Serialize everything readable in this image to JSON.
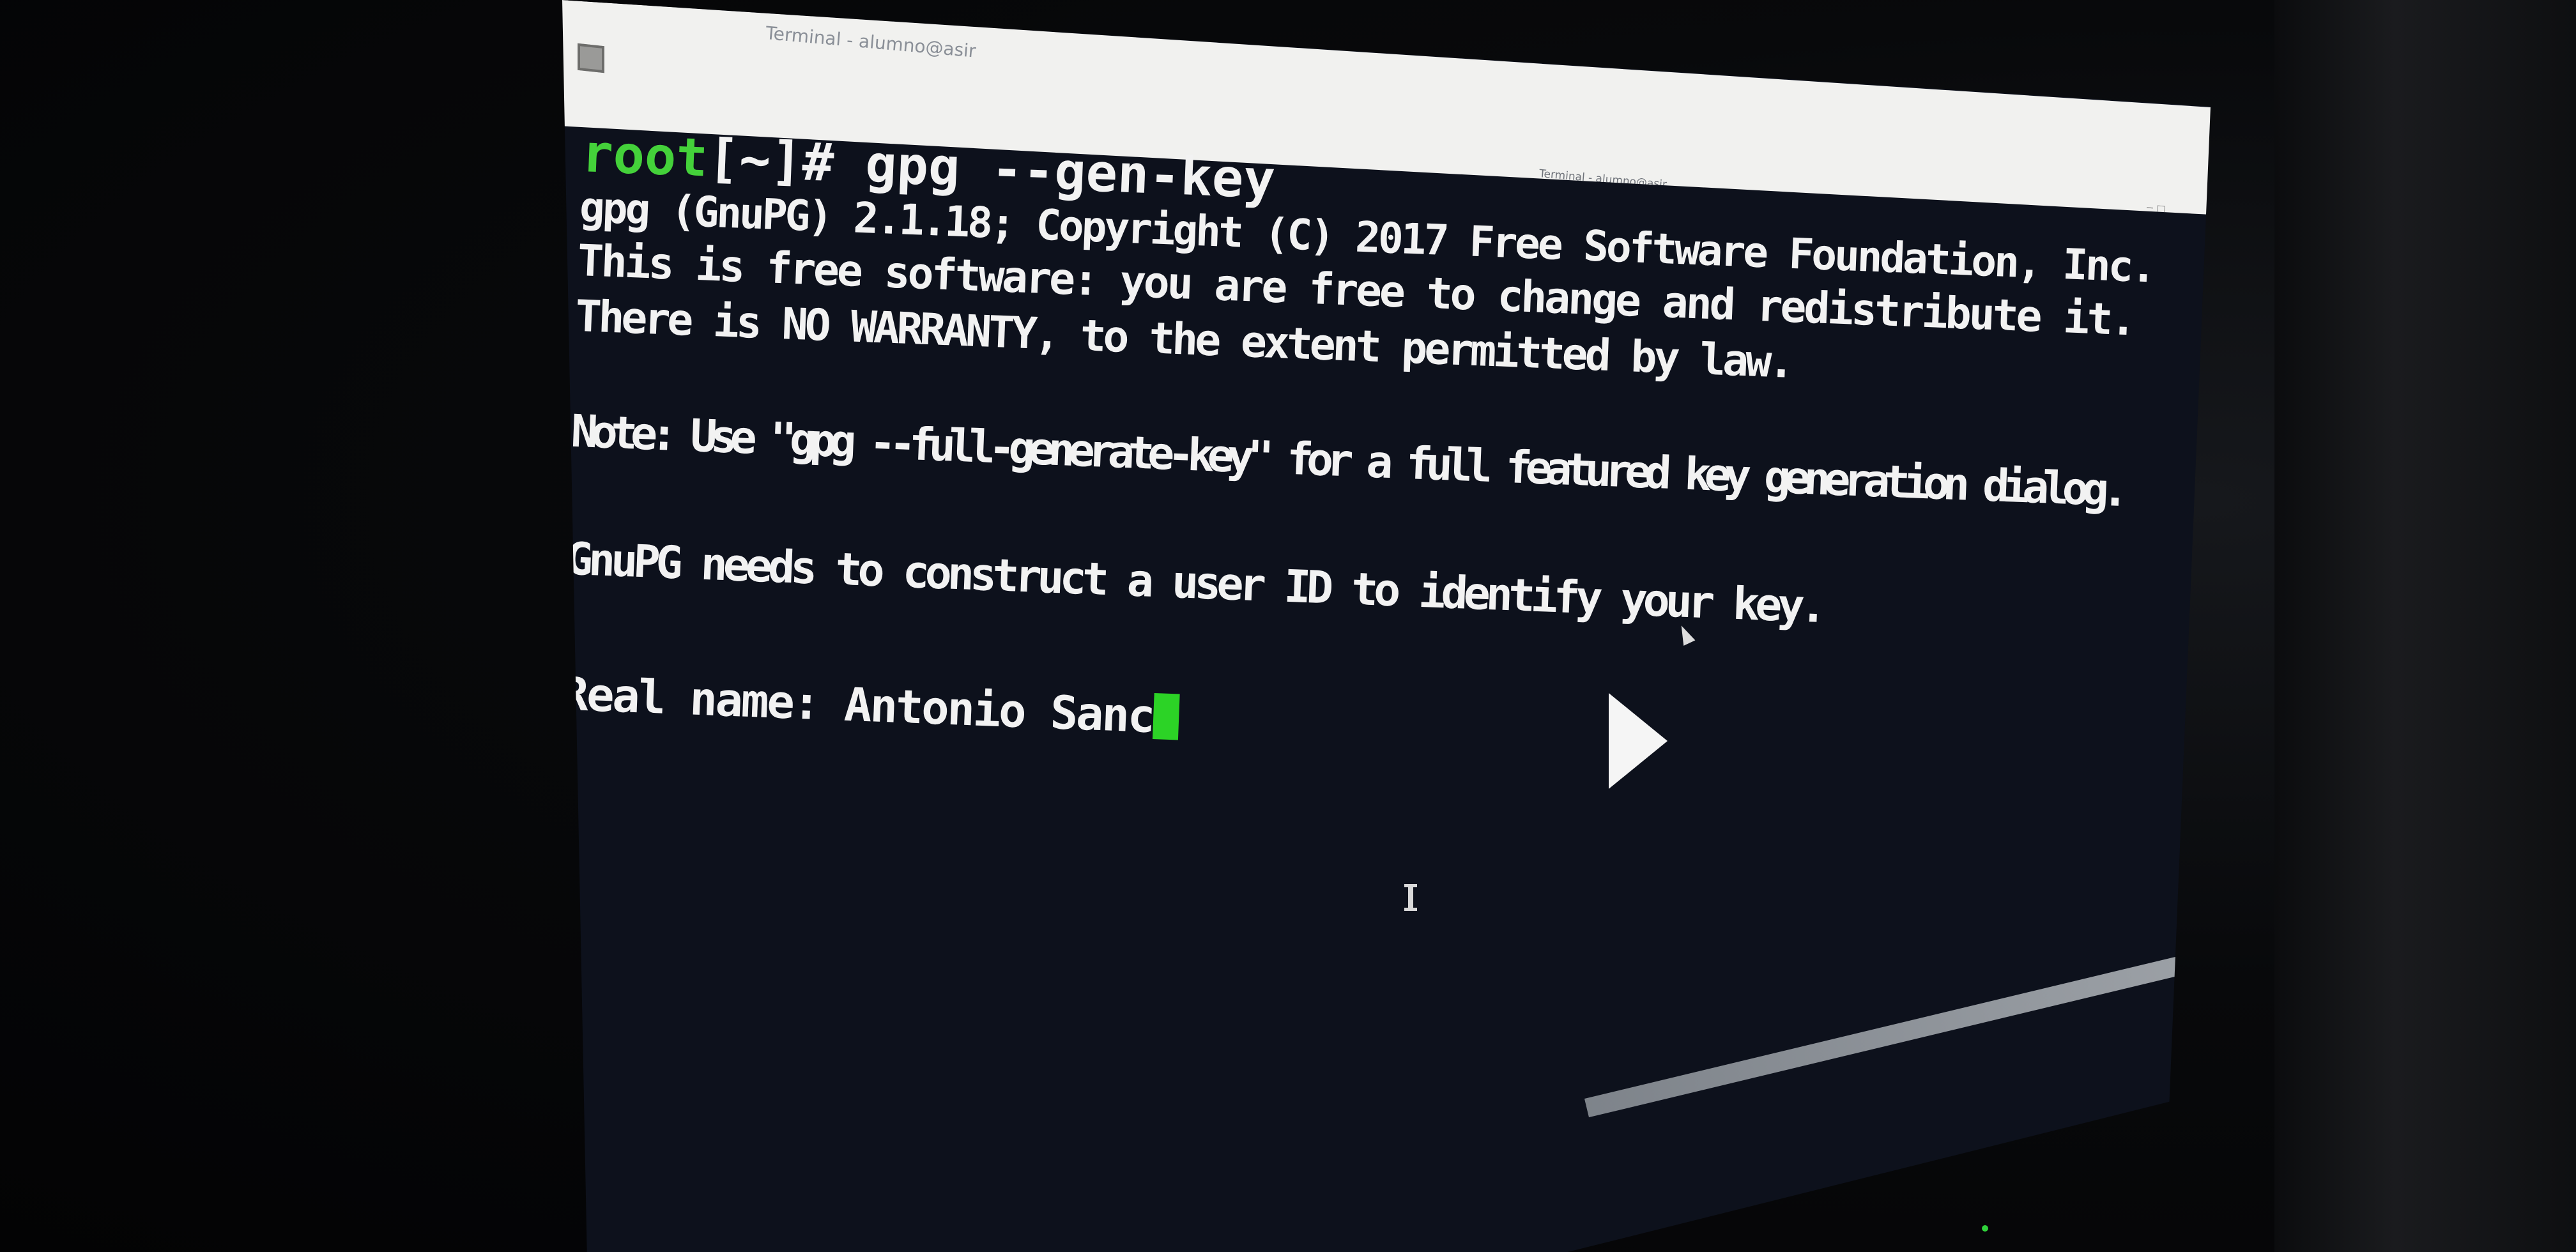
{
  "window": {
    "tab_title": "Terminal - alumno@asir",
    "title_bar_text": "Terminal - alumno@asir"
  },
  "terminal": {
    "prompt_user": "root",
    "prompt_path": "[~]# ",
    "command": "gpg --gen-key",
    "lines": [
      "gpg (GnuPG) 2.1.18; Copyright (C) 2017 Free Software Foundation, Inc.",
      "This is free software: you are free to change and redistribute it.",
      "There is NO WARRANTY, to the extent permitted by law.",
      "Note: Use \"gpg --full-generate-key\" for a full featured key generation dialog.",
      "GnuPG needs to construct a user ID to identify your key."
    ],
    "input_prompt": "Real name: ",
    "input_value": "Antonio Sanc"
  },
  "colors": {
    "terminal_background": "#0d111c",
    "prompt_user_color": "#44d13a",
    "cursor_color": "#2cd326",
    "text_color": "#f2f2f2"
  },
  "icons": {
    "play": "play-icon",
    "mouse": "mouse-pointer-icon",
    "text_cursor": "i-beam-cursor-icon"
  }
}
